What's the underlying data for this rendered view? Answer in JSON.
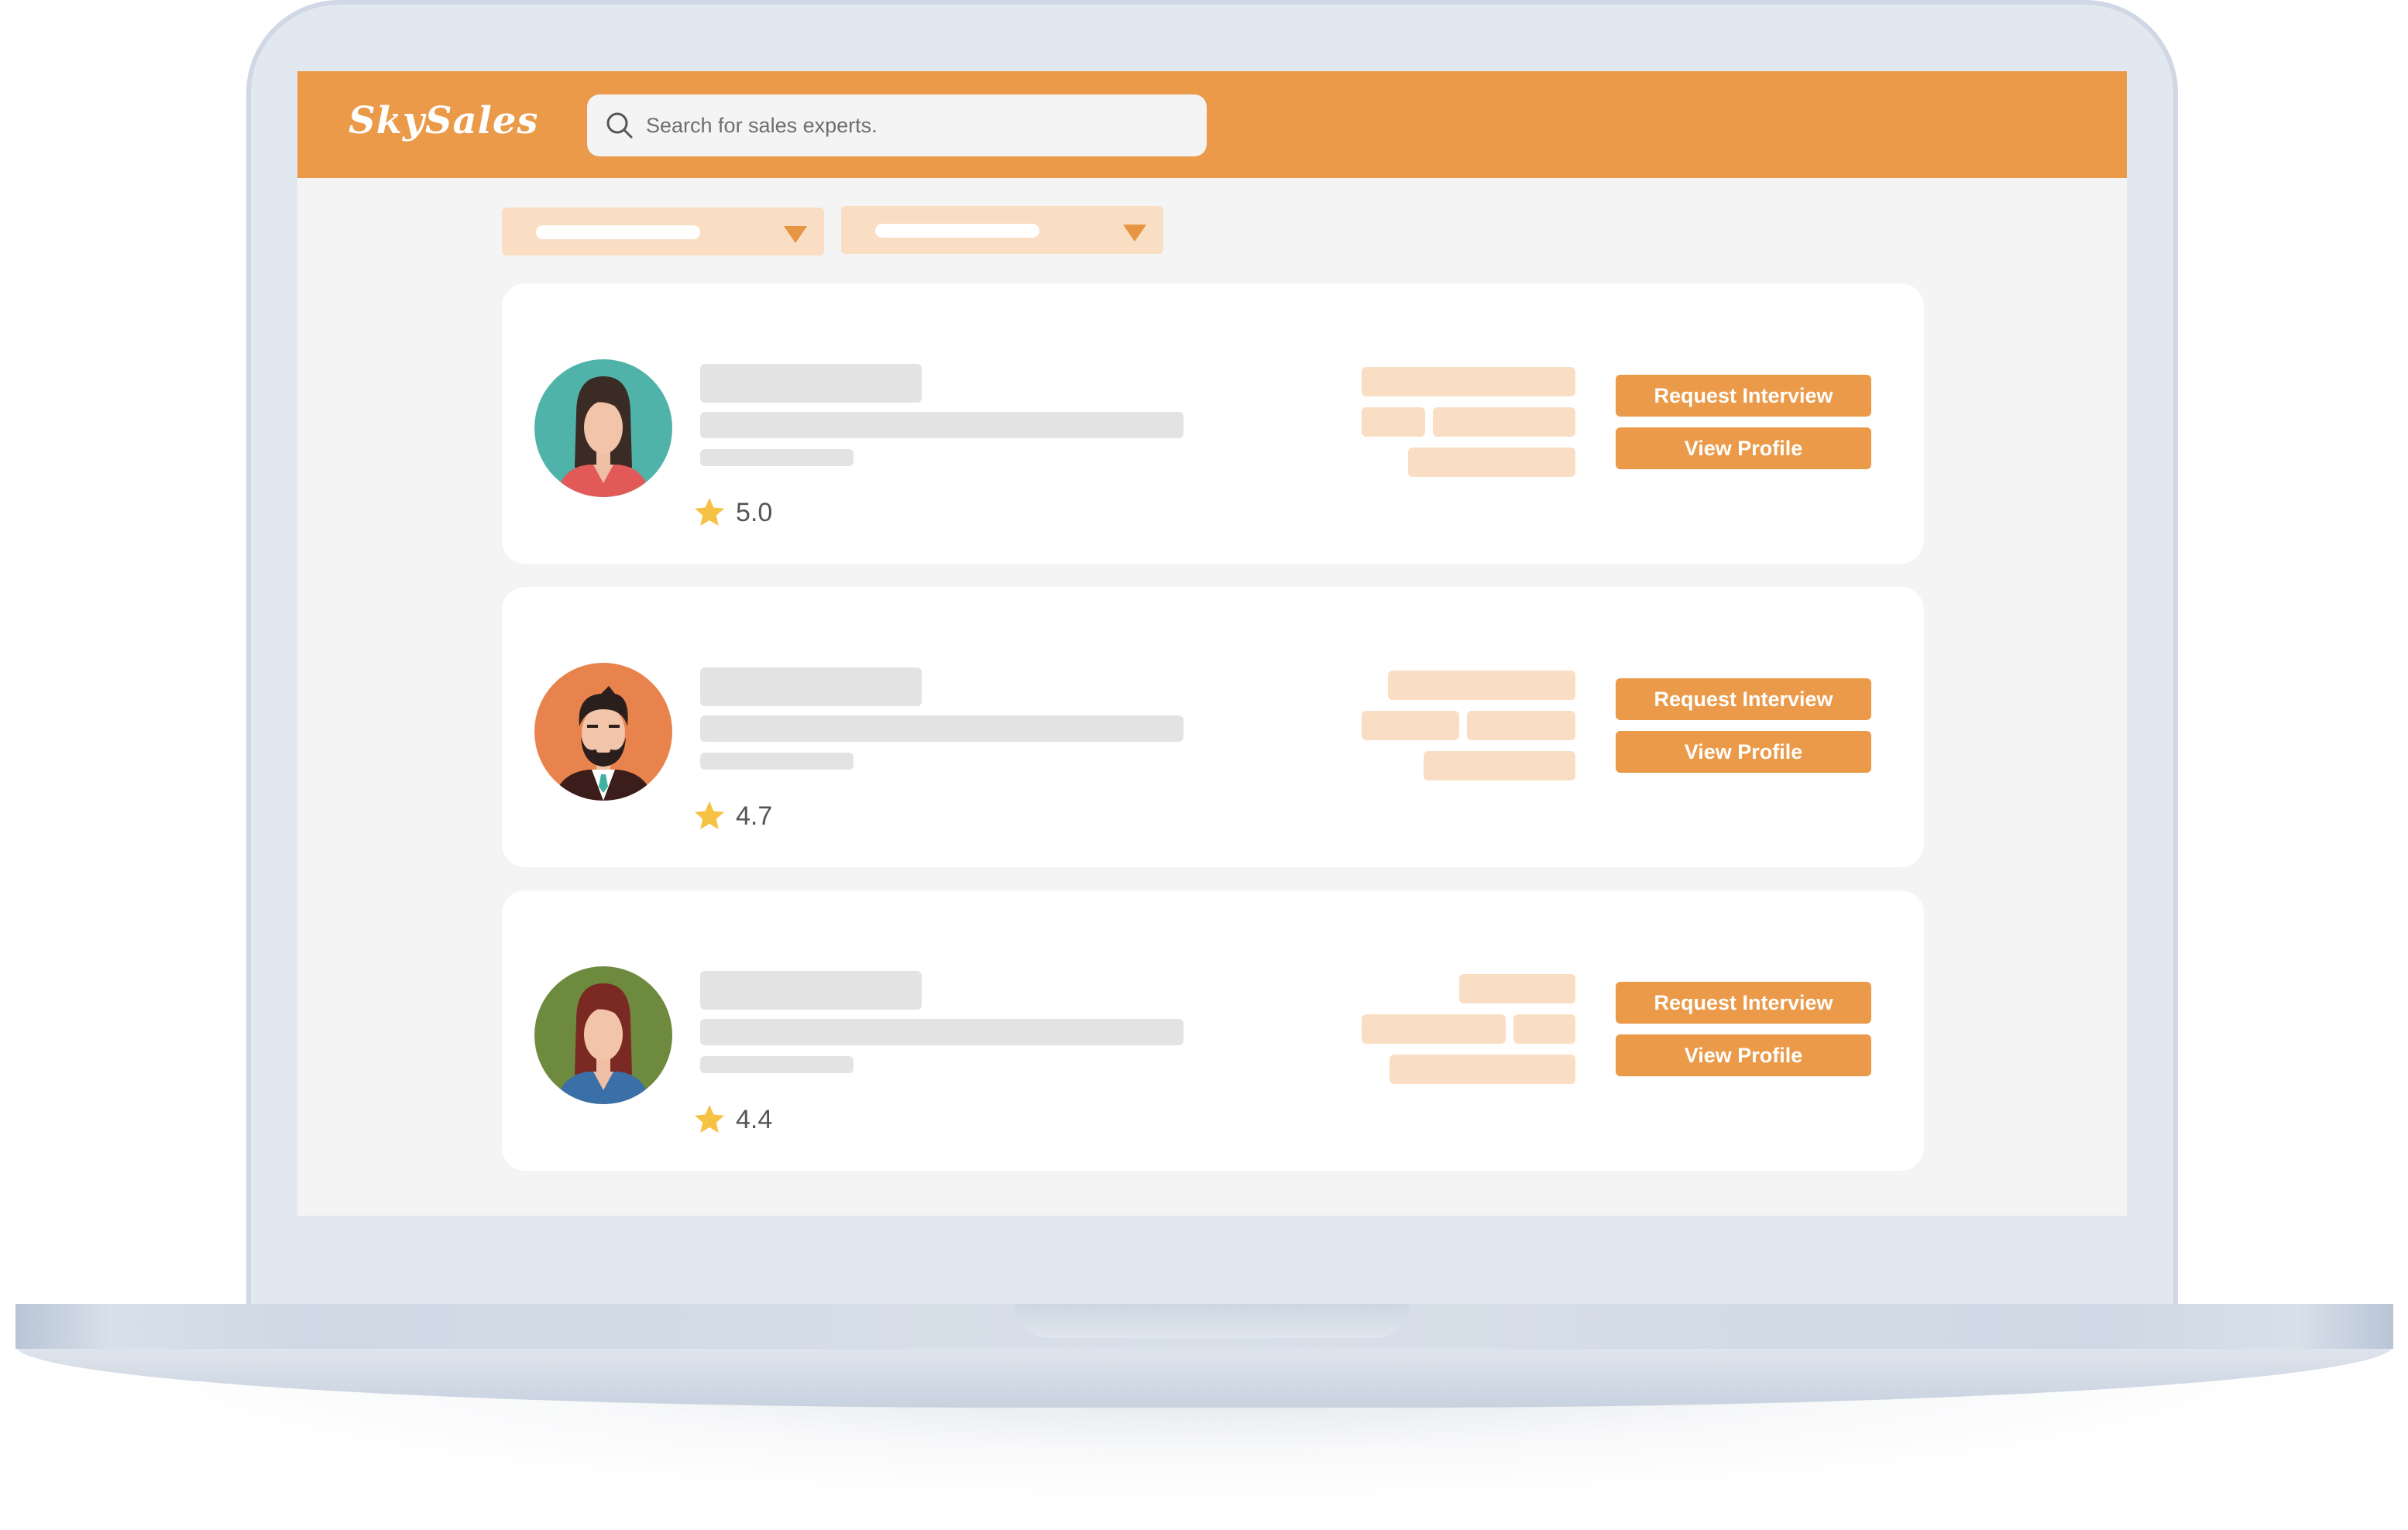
{
  "app": {
    "logo": "SkySales"
  },
  "search": {
    "placeholder": "Search for sales experts."
  },
  "filters": [
    {
      "icon": "chevron-down-icon"
    },
    {
      "icon": "chevron-down-icon"
    }
  ],
  "experts": [
    {
      "rating": "5.0",
      "request_label": "Request Interview",
      "view_label": "View Profile",
      "avatar": {
        "icon": "woman-avatar-icon",
        "background": "#50b3a9"
      }
    },
    {
      "rating": "4.7",
      "request_label": "Request Interview",
      "view_label": "View Profile",
      "avatar": {
        "icon": "bearded-man-avatar-icon",
        "background": "#e9834d"
      }
    },
    {
      "rating": "4.4",
      "request_label": "Request Interview",
      "view_label": "View Profile",
      "avatar": {
        "icon": "woman-avatar-icon",
        "background": "#6e8a3e"
      }
    }
  ],
  "colors": {
    "brand": "#ea9a48",
    "tag": "#f9dec4",
    "star": "#f5c244",
    "screen_bg": "#f4f4f4"
  }
}
